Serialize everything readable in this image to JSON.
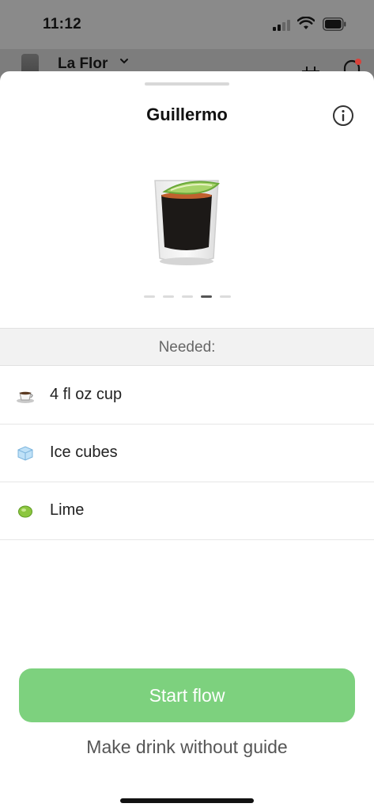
{
  "status_bar": {
    "time": "11:12"
  },
  "background_header": {
    "machine_name": "La Flor"
  },
  "sheet": {
    "title": "Guillermo",
    "image_dots": {
      "count": 5,
      "active_index": 3
    },
    "needed_label": "Needed:",
    "items": [
      {
        "icon": "coffee-cup-icon",
        "label": "4 fl oz cup"
      },
      {
        "icon": "ice-cube-icon",
        "label": "Ice cubes"
      },
      {
        "icon": "lime-icon",
        "label": "Lime"
      }
    ],
    "start_button": "Start flow",
    "guide_link": "Make drink without guide"
  },
  "colors": {
    "accent": "#7dd17e",
    "overlay": "#7d7d7d"
  }
}
